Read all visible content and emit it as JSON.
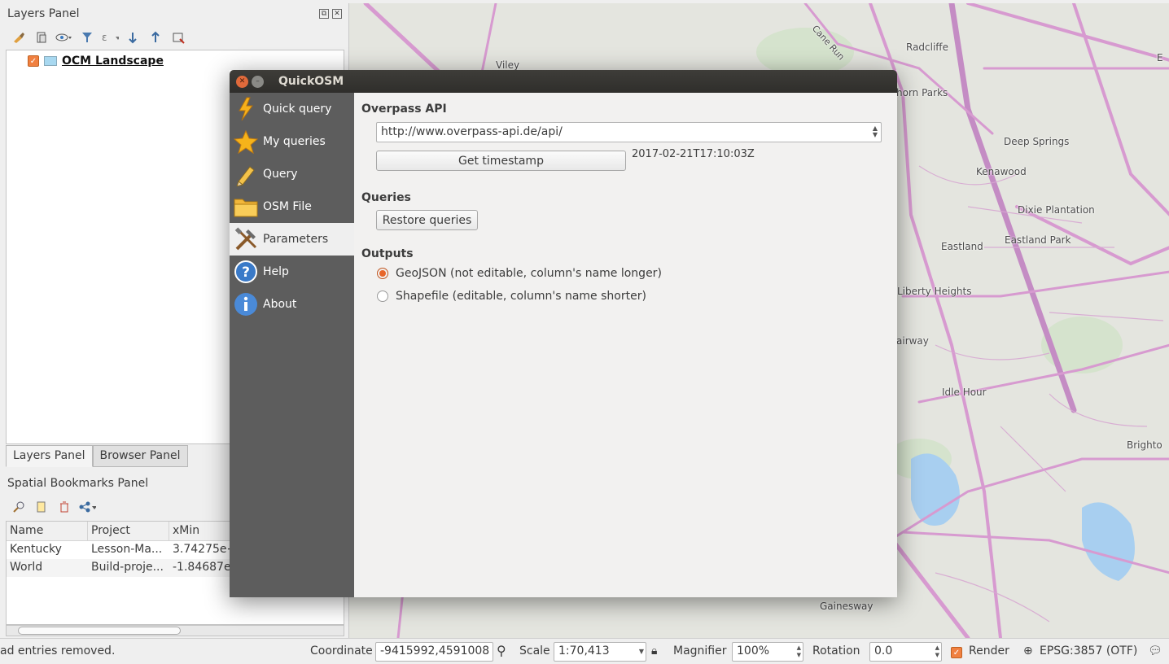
{
  "left_dock": {
    "layers_panel_title": "Layers Panel",
    "float_icon": "⧉",
    "close_icon": "✕",
    "layer_name": "OCM Landscape",
    "tabs": [
      "Layers Panel",
      "Browser Panel"
    ],
    "bookmarks_title": "Spatial Bookmarks Panel",
    "bookmarks_columns": [
      "Name",
      "Project",
      "xMin"
    ],
    "bookmarks_rows": [
      [
        "Kentucky",
        "Lesson-Ma...",
        "3.74275e+"
      ],
      [
        "World",
        "Build-proje...",
        "-1.84687e-"
      ]
    ]
  },
  "dialog": {
    "title": "QuickOSM",
    "sidebar": [
      {
        "label": "Quick query",
        "icon": "lightning-icon"
      },
      {
        "label": "My queries",
        "icon": "star-icon"
      },
      {
        "label": "Query",
        "icon": "pencil-icon"
      },
      {
        "label": "OSM File",
        "icon": "folder-icon"
      },
      {
        "label": "Parameters",
        "icon": "tools-icon"
      },
      {
        "label": "Help",
        "icon": "help-icon"
      },
      {
        "label": "About",
        "icon": "info-icon"
      }
    ],
    "overpass_title": "Overpass API",
    "overpass_url": "http://www.overpass-api.de/api/",
    "get_timestamp": "Get timestamp",
    "timestamp": "2017-02-21T17:10:03Z",
    "queries_title": "Queries",
    "restore_queries": "Restore queries",
    "outputs_title": "Outputs",
    "output_geojson": "GeoJSON (not editable, column's name longer)",
    "output_shapefile": "Shapefile (editable, column's name shorter)",
    "selected_output": "GeoJSON"
  },
  "map": {
    "labels": [
      "Radcliffe",
      "Cane Run",
      "Viley",
      "horn Parks",
      "Deep Springs",
      "Kenawood",
      "Dixie Plantation",
      "Eastland",
      "Eastland Park",
      "Liberty Heights",
      "airway",
      "Idle Hour",
      "Brighto",
      "Gainesway",
      "E"
    ]
  },
  "statusbar": {
    "message": "ad entries removed.",
    "coordinate_label": "Coordinate",
    "coordinate_value": "-9415992,4591008",
    "scale_label": "Scale",
    "scale_value": "1:70,413",
    "magnifier_label": "Magnifier",
    "magnifier_value": "100%",
    "rotation_label": "Rotation",
    "rotation_value": "0.0",
    "render_label": "Render",
    "crs": "EPSG:3857 (OTF)"
  },
  "colors": {
    "accent": "#e8662a",
    "sidebar_bg": "#5d5d5d",
    "titlebar_bg": "#3a3935",
    "map_bg": "#e4e5df",
    "road": "#d79ad0"
  }
}
